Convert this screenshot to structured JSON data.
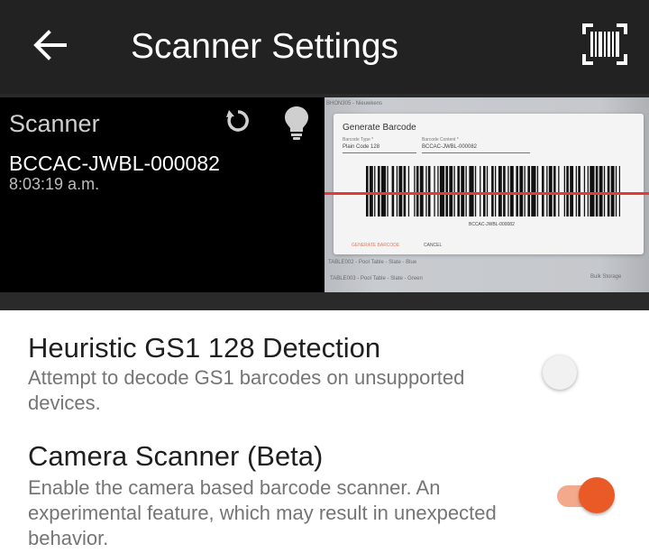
{
  "appbar": {
    "title": "Scanner Settings",
    "back_icon": "arrow-back-icon",
    "scan_icon": "barcode-scan-icon"
  },
  "scanner": {
    "label": "Scanner",
    "reset_icon": "reset-icon",
    "light_icon": "lightbulb-icon",
    "last_code": "BCCAC-JWBL-000082",
    "last_time": "8:03:19 a.m."
  },
  "camera_feed": {
    "dialog_title": "Generate Barcode",
    "type_label": "Barcode Type *",
    "type_value": "Plain Code 128",
    "content_label": "Barcode Content *",
    "content_value": "BCCAC-JWBL-000082",
    "barcode_text": "BCCAC-JWBL-000082",
    "generate_label": "GENERATE BARCODE",
    "cancel_label": "CANCEL",
    "bg_rows": [
      "BHON305 - Nieuwkens",
      "TABLE002 - Pool Table - Slate - Blue",
      "TABLE003 - Pool Table - Slate - Green",
      "Bulk Storage"
    ]
  },
  "settings": [
    {
      "title": "Heuristic GS1 128 Detection",
      "description": "Attempt to decode GS1 barcodes on unsupported devices.",
      "enabled": false
    },
    {
      "title": "Camera Scanner (Beta)",
      "description": "Enable the camera based barcode scanner. An experimental feature, which may result in unexpected behavior.",
      "enabled": true
    }
  ],
  "colors": {
    "appbar": "#222222",
    "accent": "#ea5a27",
    "accent_track": "#f3a98c",
    "scan_line": "#e53935"
  }
}
